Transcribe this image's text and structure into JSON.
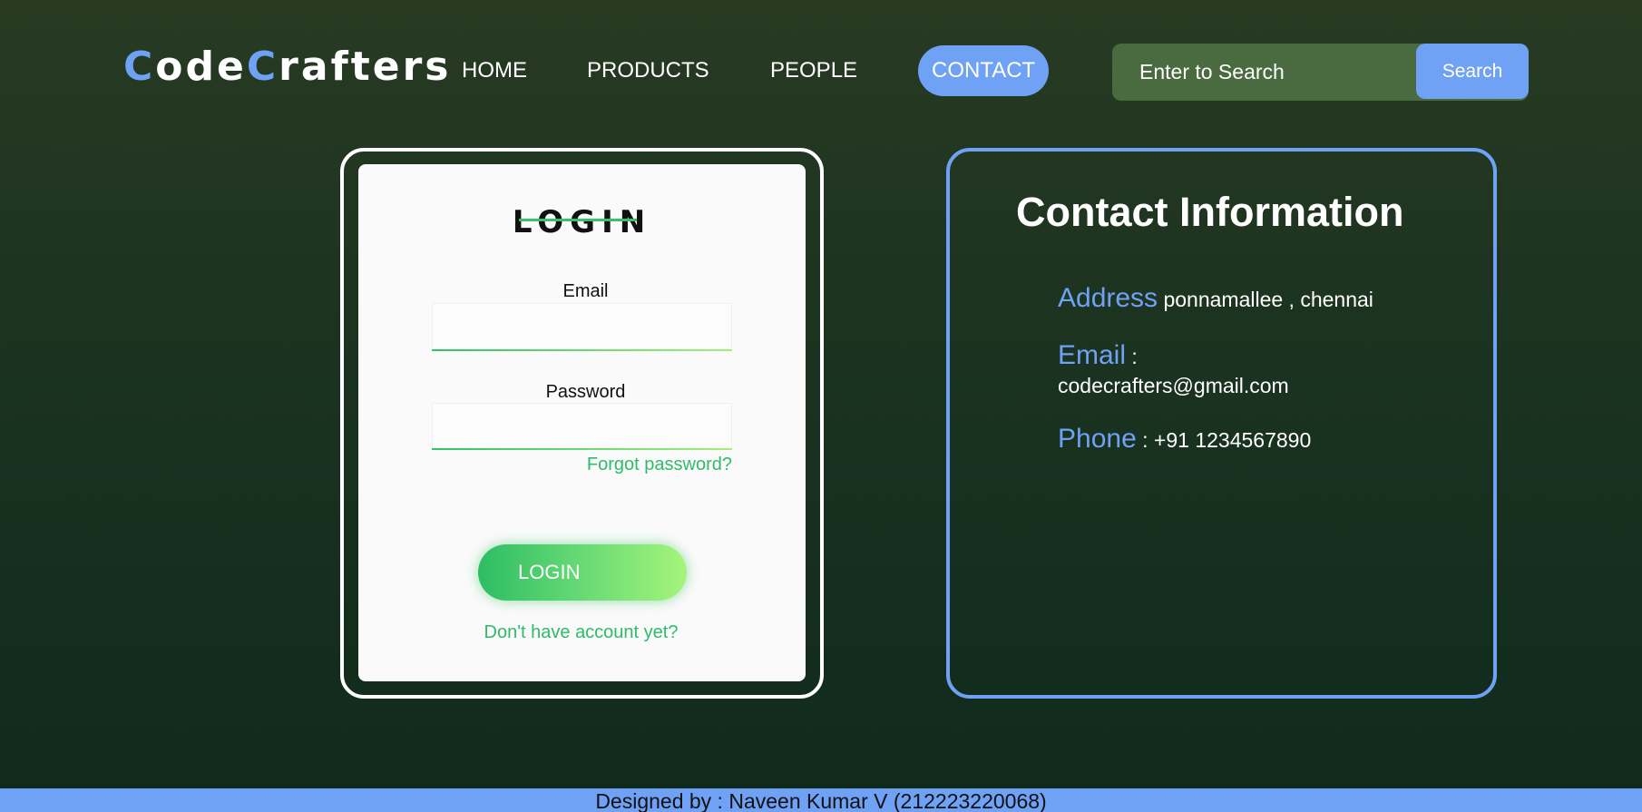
{
  "header": {
    "logo": {
      "first_initial": "C",
      "first_rest": "ode",
      "second_initial": "C",
      "second_rest": "rafters"
    },
    "nav": [
      {
        "label": "HOME"
      },
      {
        "label": "PRODUCTS"
      },
      {
        "label": "PEOPLE"
      },
      {
        "label": "CONTACT",
        "active": true
      }
    ],
    "search": {
      "placeholder": "Enter to Search",
      "value": "",
      "button_label": "Search"
    }
  },
  "login": {
    "title": "LOGIN",
    "email_label": "Email",
    "email_value": "",
    "password_label": "Password",
    "password_value": "",
    "forgot_link": "Forgot password?",
    "submit_label": "LOGIN",
    "signup_link": "Don't have account yet?"
  },
  "contact": {
    "title": "Contact Information",
    "address": {
      "label": "Address",
      "value": "ponnamallee , chennai"
    },
    "email": {
      "label": "Email",
      "separator": " :",
      "value": "codecrafters@gmail.com"
    },
    "phone": {
      "label": "Phone",
      "value": ": +91 1234567890"
    }
  },
  "footer": {
    "text": "Designed by : Naveen Kumar V (212223220068)"
  },
  "colors": {
    "accent_blue": "#6fa1f5",
    "accent_green": "#2fbb6a",
    "search_bg": "#4a6b3f"
  }
}
